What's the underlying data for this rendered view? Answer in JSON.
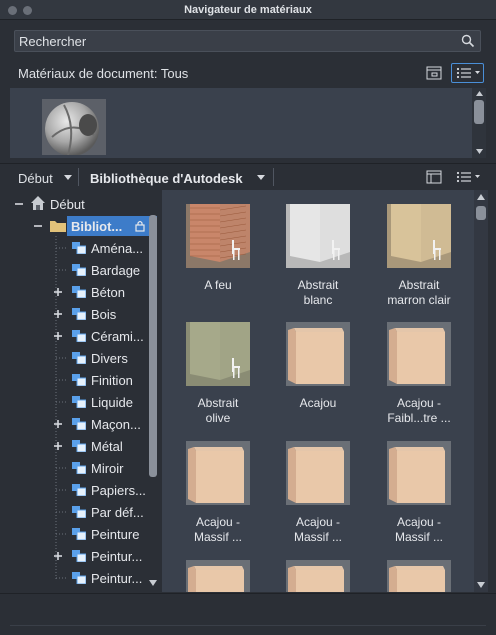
{
  "window": {
    "title": "Navigateur de matériaux"
  },
  "search": {
    "placeholder": "Rechercher",
    "value": ""
  },
  "document_materials": {
    "label": "Matériaux de document: Tous"
  },
  "library_bar": {
    "home_label": "Début",
    "library_label": "Bibliothèque d'Autodesk"
  },
  "tree": {
    "root": "Début",
    "library": "Bibliot...",
    "items": [
      {
        "label": "Aména...",
        "expandable": false
      },
      {
        "label": "Bardage",
        "expandable": false
      },
      {
        "label": "Béton",
        "expandable": true
      },
      {
        "label": "Bois",
        "expandable": true
      },
      {
        "label": "Cérami...",
        "expandable": true
      },
      {
        "label": "Divers",
        "expandable": false
      },
      {
        "label": "Finition",
        "expandable": false
      },
      {
        "label": "Liquide",
        "expandable": false
      },
      {
        "label": "Maçon...",
        "expandable": true
      },
      {
        "label": "Métal",
        "expandable": true
      },
      {
        "label": "Miroir",
        "expandable": false
      },
      {
        "label": "Papiers...",
        "expandable": false
      },
      {
        "label": "Par déf...",
        "expandable": false
      },
      {
        "label": "Peinture",
        "expandable": false
      },
      {
        "label": "Peintur...",
        "expandable": true
      },
      {
        "label": "Peintur...",
        "expandable": false
      }
    ]
  },
  "materials": [
    {
      "line1": "A feu",
      "line2": "",
      "kind": "brick-wall"
    },
    {
      "line1": "Abstrait",
      "line2": "blanc",
      "kind": "white-wall"
    },
    {
      "line1": "Abstrait",
      "line2": "marron clair",
      "kind": "tan-wall"
    },
    {
      "line1": "Abstrait",
      "line2": "olive",
      "kind": "olive-wall"
    },
    {
      "line1": "Acajou",
      "line2": "",
      "kind": "wood-cube"
    },
    {
      "line1": "Acajou -",
      "line2": "Faibl...tre ...",
      "kind": "wood-cube"
    },
    {
      "line1": "Acajou -",
      "line2": "Massif ...",
      "kind": "wood-cube"
    },
    {
      "line1": "Acajou -",
      "line2": "Massif ...",
      "kind": "wood-cube"
    },
    {
      "line1": "Acajou -",
      "line2": "Massif ...",
      "kind": "wood-cube"
    },
    {
      "line1": "",
      "line2": "",
      "kind": "wood-cube"
    },
    {
      "line1": "",
      "line2": "",
      "kind": "wood-cube"
    },
    {
      "line1": "",
      "line2": "",
      "kind": "wood-cube"
    }
  ],
  "colors": {
    "accent": "#3d7cc9",
    "panel": "#3a414d",
    "background": "#2b2f36"
  }
}
